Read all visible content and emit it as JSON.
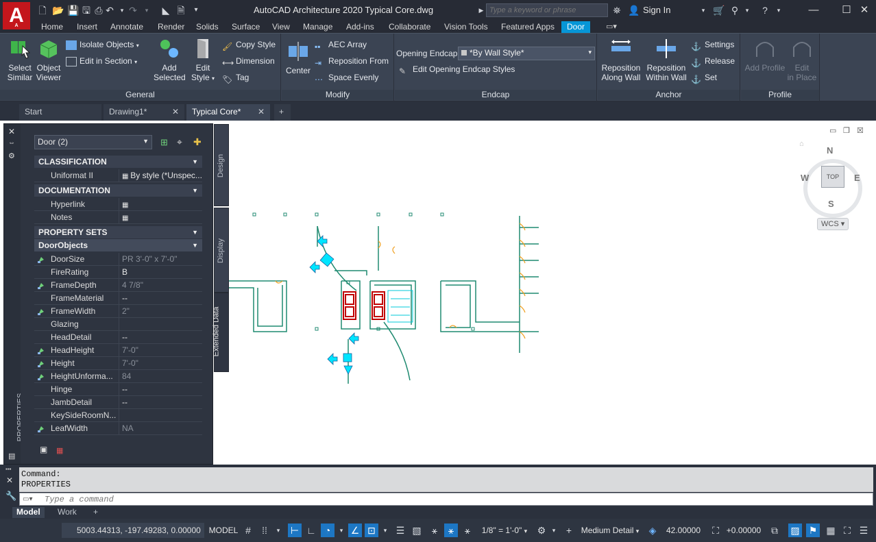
{
  "app": {
    "title": "AutoCAD Architecture 2020   Typical Core.dwg",
    "logo_letter": "A",
    "logo_sub": "A",
    "search_placeholder": "Type a keyword or phrase",
    "sign_in": "Sign In"
  },
  "ribbon_tabs": [
    "Home",
    "Insert",
    "Annotate",
    "Render",
    "Solids",
    "Surface",
    "View",
    "Manage",
    "Add-ins",
    "Collaborate",
    "Vision Tools",
    "Featured Apps",
    "Door"
  ],
  "active_tab": "Door",
  "ribbon": {
    "general": {
      "title": "General",
      "select_similar": [
        "Select",
        "Similar"
      ],
      "object_viewer": [
        "Object",
        "Viewer"
      ],
      "isolate_objects": "Isolate Objects",
      "edit_in_section": "Edit in Section",
      "add_selected": [
        "Add",
        "Selected"
      ],
      "edit_style": [
        "Edit",
        "Style"
      ],
      "copy_style": "Copy Style",
      "dimension": "Dimension",
      "tag": "Tag"
    },
    "modify": {
      "title": "Modify",
      "center": "Center",
      "aec_array": "AEC Array",
      "reposition_from": "Reposition From",
      "space_evenly": "Space Evenly"
    },
    "endcap": {
      "title": "Endcap",
      "opening_endcap_label": "Opening Endcap",
      "opening_endcap_value": "*By Wall Style*",
      "edit_opening_endcap_styles": "Edit Opening Endcap Styles"
    },
    "anchor": {
      "title": "Anchor",
      "reposition_along_wall": [
        "Reposition",
        "Along Wall"
      ],
      "reposition_within_wall": [
        "Reposition",
        "Within Wall"
      ],
      "settings": "Settings",
      "release": "Release",
      "set": "Set"
    },
    "profile": {
      "title": "Profile",
      "add_profile": "Add Profile",
      "edit_in_place": [
        "Edit",
        "in Place"
      ]
    }
  },
  "doc_tabs": [
    {
      "label": "Start",
      "closable": false
    },
    {
      "label": "Drawing1*",
      "closable": true
    },
    {
      "label": "Typical Core*",
      "closable": true
    }
  ],
  "properties": {
    "palette_title": "PROPERTIES",
    "selection": "Door (2)",
    "side_tabs": [
      "Design",
      "Display",
      "Extended Data"
    ],
    "sections": {
      "classification": "CLASSIFICATION",
      "documentation": "DOCUMENTATION",
      "property_sets": "PROPERTY SETS",
      "door_objects": "DoorObjects"
    },
    "classification_rows": [
      {
        "name": "Uniformat II",
        "value": "By style (*Unspec..."
      }
    ],
    "documentation_rows": [
      {
        "name": "Hyperlink",
        "value": ""
      },
      {
        "name": "Notes",
        "value": ""
      }
    ],
    "door_rows": [
      {
        "name": "DoorSize",
        "value": "PR 3'-0\" x 7'-0\"",
        "grey": true,
        "locked": true
      },
      {
        "name": "FireRating",
        "value": "B",
        "grey": false,
        "locked": false
      },
      {
        "name": "FrameDepth",
        "value": "4 7/8\"",
        "grey": true,
        "locked": true
      },
      {
        "name": "FrameMaterial",
        "value": "--",
        "grey": false,
        "locked": false
      },
      {
        "name": "FrameWidth",
        "value": "2\"",
        "grey": true,
        "locked": true
      },
      {
        "name": "Glazing",
        "value": "",
        "grey": false,
        "locked": false
      },
      {
        "name": "HeadDetail",
        "value": "--",
        "grey": false,
        "locked": false
      },
      {
        "name": "HeadHeight",
        "value": "7'-0\"",
        "grey": true,
        "locked": true
      },
      {
        "name": "Height",
        "value": "7'-0\"",
        "grey": true,
        "locked": true
      },
      {
        "name": "HeightUnforma...",
        "value": "84",
        "grey": true,
        "locked": true
      },
      {
        "name": "Hinge",
        "value": "--",
        "grey": false,
        "locked": false
      },
      {
        "name": "JambDetail",
        "value": "--",
        "grey": false,
        "locked": false
      },
      {
        "name": "KeySideRoomN...",
        "value": "",
        "grey": false,
        "locked": false
      },
      {
        "name": "LeafWidth",
        "value": "NA",
        "grey": true,
        "locked": true
      }
    ]
  },
  "viewcube": {
    "north": "N",
    "south": "S",
    "east": "E",
    "west": "W",
    "face": "TOP",
    "wcs": "WCS"
  },
  "command": {
    "history": [
      "Command:",
      "PROPERTIES"
    ],
    "placeholder": "Type a command"
  },
  "layout_tabs": [
    "Model",
    "Work"
  ],
  "status": {
    "coordinates": "5003.44313, -197.49283, 0.00000",
    "model": "MODEL",
    "annotation_scale": "1/8\" = 1'-0\"",
    "detail_level": "Medium Detail",
    "elevation": "42.00000",
    "cut_plane": "+0.00000"
  },
  "colors": {
    "accent": "#0696d7",
    "ribbon_bg": "#3b4453",
    "door_cyan": "#00ffff",
    "wall_green": "#007f5f",
    "red_fixture": "#c00000"
  }
}
